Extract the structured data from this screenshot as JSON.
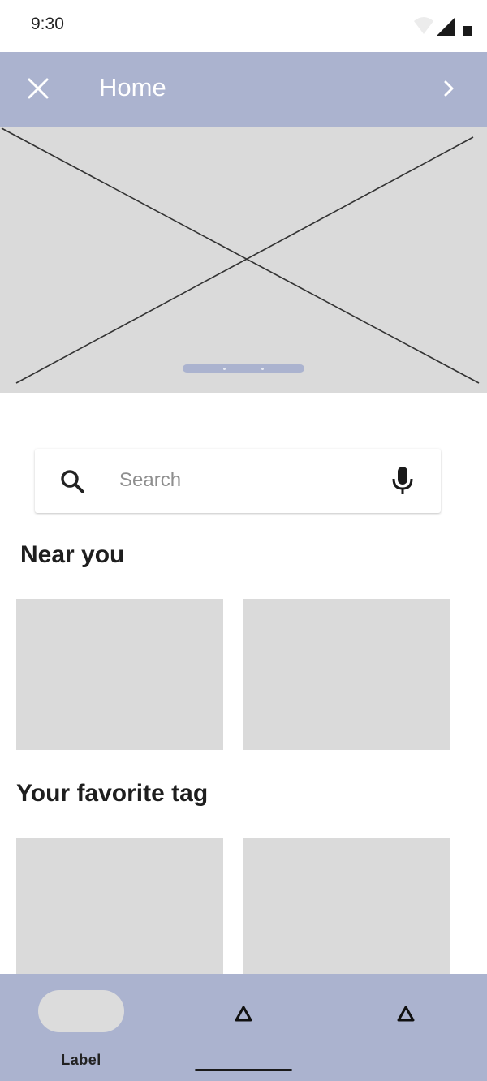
{
  "status_bar": {
    "time": "9:30"
  },
  "app_bar": {
    "title": "Home"
  },
  "search": {
    "placeholder": "Search"
  },
  "sections": {
    "near": {
      "title": "Near you"
    },
    "favorite": {
      "title": "Your favorite tag"
    }
  },
  "bottom_nav": {
    "items": [
      {
        "label": "Label",
        "icon": "pill-placeholder",
        "active": true
      },
      {
        "label": "",
        "icon": "triangle-icon"
      },
      {
        "label": "",
        "icon": "triangle-icon"
      }
    ]
  },
  "colors": {
    "accent": "#abb3cf",
    "placeholder": "#dadada",
    "text": "#1e1e1e"
  },
  "icons": {
    "close": "close-icon",
    "next": "chevron-right-icon",
    "search": "search-icon",
    "mic": "mic-icon",
    "wifi": "wifi-icon",
    "signal": "signal-icon",
    "battery": "battery-icon"
  }
}
